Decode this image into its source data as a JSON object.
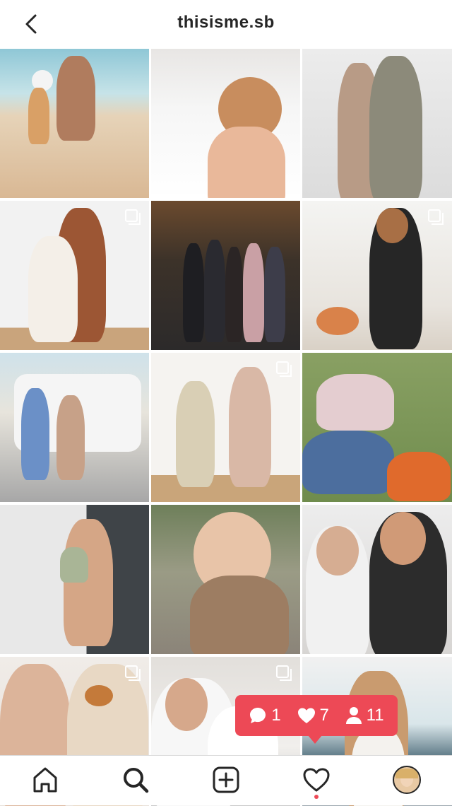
{
  "header": {
    "username": "thisisme.sb"
  },
  "icons": {
    "back": "chevron-left-icon",
    "home": "home-icon",
    "search": "search-icon",
    "new_post": "plus-square-icon",
    "activity": "heart-icon",
    "multi": "multiple-posts-icon"
  },
  "notification": {
    "comments": "1",
    "likes": "7",
    "follows": "11",
    "color": "#ed4956"
  }
}
